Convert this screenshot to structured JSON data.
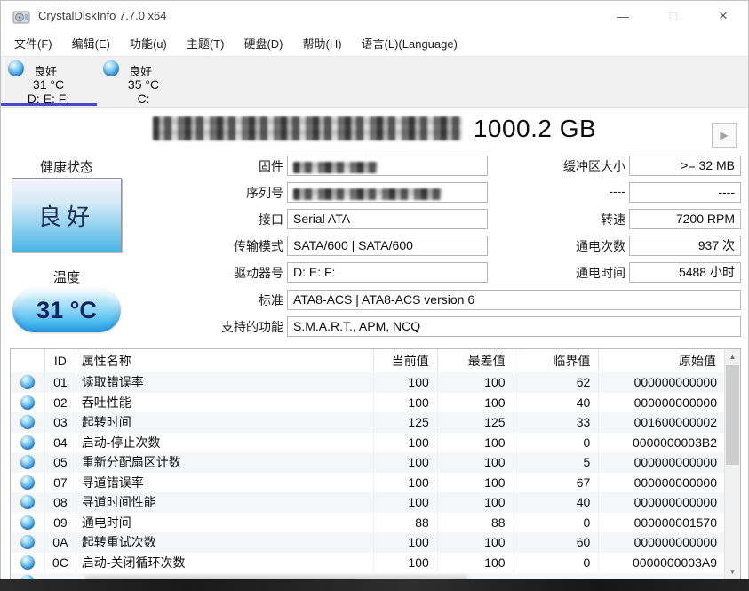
{
  "window": {
    "title": "CrystalDiskInfo 7.7.0 x64"
  },
  "icons": {
    "minimize": "—",
    "maximize": "□",
    "close": "×",
    "next_drive": "▶",
    "scroll_up": "▲",
    "scroll_down": "▼"
  },
  "colors": {
    "tab_underline": "#4b49c8",
    "health_good_blue": "#49b4e6",
    "orb_blue": "#44a4e2"
  },
  "menu": [
    "文件(F)",
    "编辑(E)",
    "功能(u)",
    "主题(T)",
    "硬盘(D)",
    "帮助(H)",
    "语言(L)(Language)"
  ],
  "tabs": [
    {
      "status": "良好",
      "temp": "31 °C",
      "drive": "D: E: F:",
      "selected": true
    },
    {
      "status": "良好",
      "temp": "35 °C",
      "drive": "C:",
      "selected": false
    }
  ],
  "disk": {
    "model_redacted": true,
    "size": "1000.2 GB",
    "health_label": "健康状态",
    "health_value": "良好",
    "temp_label": "温度",
    "temp_value": "31 °C",
    "fields_mid": [
      {
        "label": "固件",
        "value": "",
        "redacted": true
      },
      {
        "label": "序列号",
        "value": "",
        "redacted": true
      },
      {
        "label": "接口",
        "value": "Serial ATA",
        "redacted": false
      },
      {
        "label": "传输模式",
        "value": "SATA/600 | SATA/600",
        "redacted": false
      },
      {
        "label": "驱动器号",
        "value": "D: E: F:",
        "redacted": false
      }
    ],
    "fields_wide": [
      {
        "label": "标准",
        "value": "ATA8-ACS | ATA8-ACS version 6"
      },
      {
        "label": "支持的功能",
        "value": "S.M.A.R.T., APM, NCQ"
      }
    ],
    "fields_right": [
      {
        "label": "缓冲区大小",
        "value": ">= 32 MB"
      },
      {
        "label": "----",
        "value": "----"
      },
      {
        "label": "转速",
        "value": "7200 RPM"
      },
      {
        "label": "通电次数",
        "value": "937 次"
      },
      {
        "label": "通电时间",
        "value": "5488 小时"
      }
    ]
  },
  "smart_table": {
    "headers": [
      "ID",
      "属性名称",
      "当前值",
      "最差值",
      "临界值",
      "原始值"
    ],
    "rows": [
      [
        "01",
        "读取错误率",
        "100",
        "100",
        "62",
        "000000000000"
      ],
      [
        "02",
        "吞吐性能",
        "100",
        "100",
        "40",
        "000000000000"
      ],
      [
        "03",
        "起转时间",
        "125",
        "125",
        "33",
        "001600000002"
      ],
      [
        "04",
        "启动-停止次数",
        "100",
        "100",
        "0",
        "0000000003B2"
      ],
      [
        "05",
        "重新分配扇区计数",
        "100",
        "100",
        "5",
        "000000000000"
      ],
      [
        "07",
        "寻道错误率",
        "100",
        "100",
        "67",
        "000000000000"
      ],
      [
        "08",
        "寻道时间性能",
        "100",
        "100",
        "40",
        "000000000000"
      ],
      [
        "09",
        "通电时间",
        "88",
        "88",
        "0",
        "000000001570"
      ],
      [
        "0A",
        "起转重试次数",
        "100",
        "100",
        "60",
        "000000000000"
      ],
      [
        "0C",
        "启动-关闭循环次数",
        "100",
        "100",
        "0",
        "0000000003A9"
      ]
    ]
  }
}
